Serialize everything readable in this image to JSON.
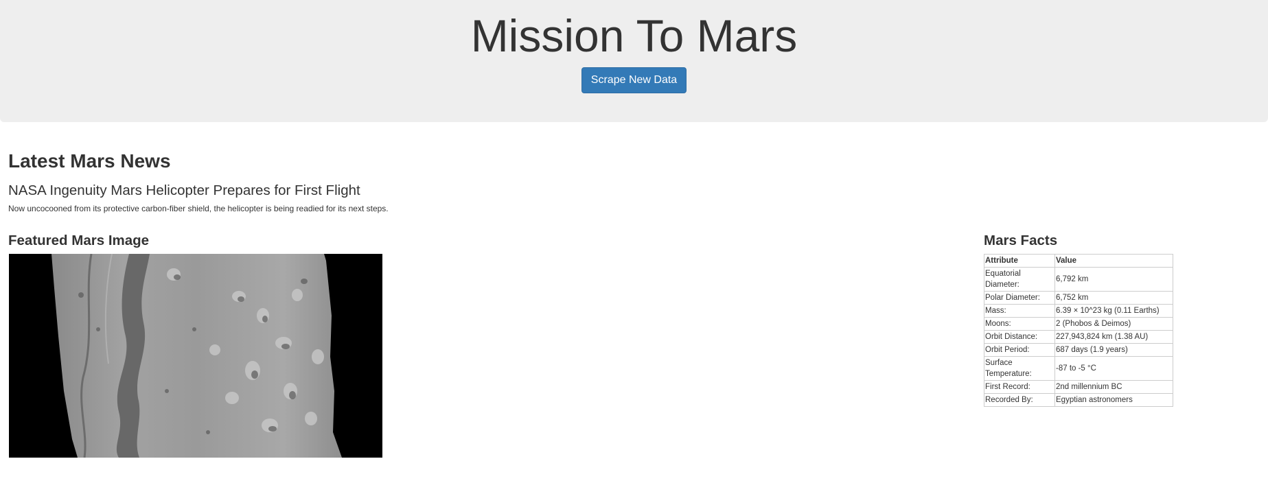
{
  "header": {
    "title": "Mission To Mars",
    "scrape_button_label": "Scrape New Data"
  },
  "news": {
    "section_title": "Latest Mars News",
    "headline": "NASA Ingenuity Mars Helicopter Prepares for First Flight",
    "teaser": "Now uncocooned from its protective carbon-fiber shield, the helicopter is being readied for its next steps."
  },
  "featured_image": {
    "section_title": "Featured Mars Image"
  },
  "facts": {
    "section_title": "Mars Facts",
    "columns": [
      "Attribute",
      "Value"
    ],
    "rows": [
      {
        "attribute": "Equatorial Diameter:",
        "value": "6,792 km"
      },
      {
        "attribute": "Polar Diameter:",
        "value": "6,752 km"
      },
      {
        "attribute": "Mass:",
        "value": "6.39 × 10^23 kg (0.11 Earths)"
      },
      {
        "attribute": "Moons:",
        "value": "2 (Phobos & Deimos)"
      },
      {
        "attribute": "Orbit Distance:",
        "value": "227,943,824 km (1.38 AU)"
      },
      {
        "attribute": "Orbit Period:",
        "value": "687 days (1.9 years)"
      },
      {
        "attribute": "Surface Temperature:",
        "value": "-87 to -5 °C"
      },
      {
        "attribute": "First Record:",
        "value": "2nd millennium BC"
      },
      {
        "attribute": "Recorded By:",
        "value": "Egyptian astronomers"
      }
    ]
  },
  "colors": {
    "header_bg": "#eeeeee",
    "button_bg": "#337ab7",
    "text": "#333333"
  }
}
